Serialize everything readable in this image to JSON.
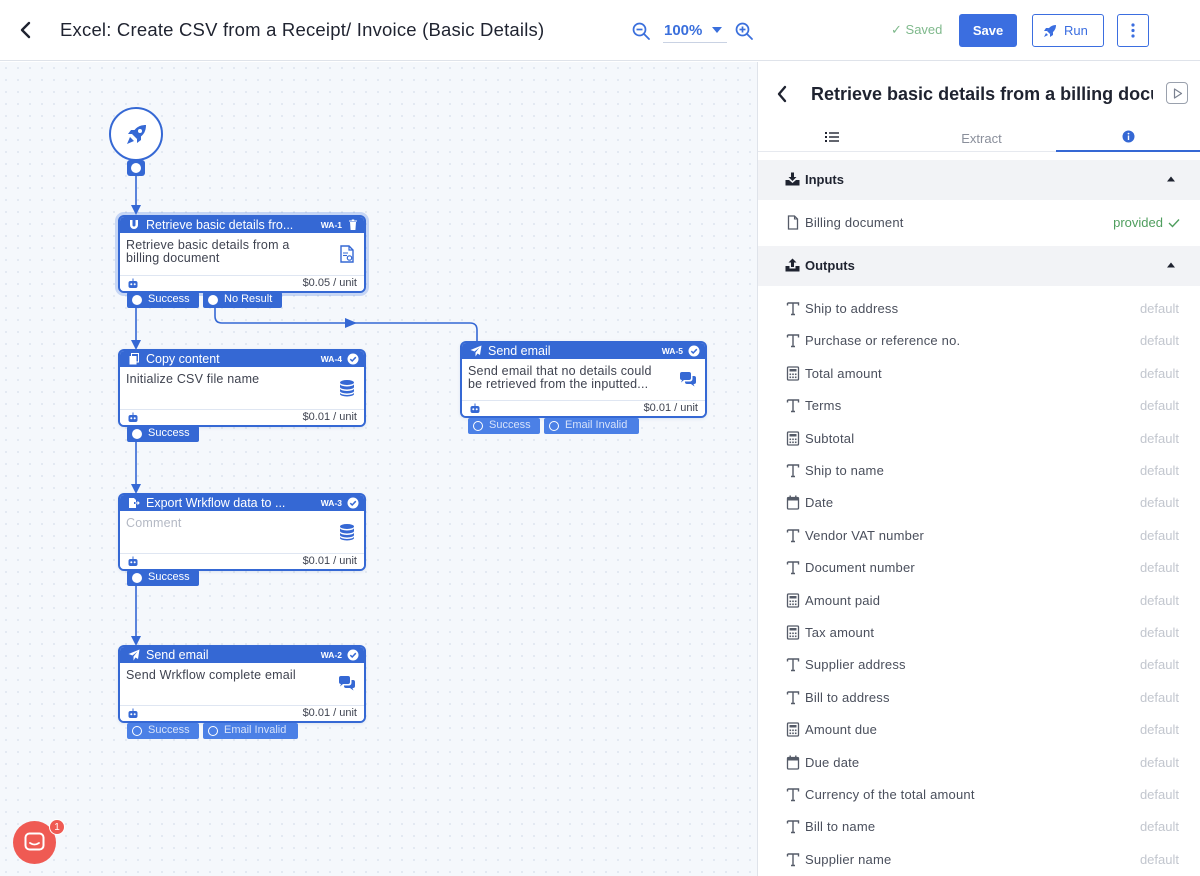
{
  "header": {
    "title": "Excel: Create CSV from a Receipt/ Invoice (Basic Details)",
    "zoom": "100%",
    "saved_label": "Saved",
    "save_label": "Save",
    "run_label": "Run"
  },
  "canvas": {
    "nodes": [
      {
        "title": "Retrieve basic details fro...",
        "id": "WA-1",
        "body": "Retrieve basic details from a billing document",
        "price": "$0.05 / unit",
        "ports": [
          "Success",
          "No Result"
        ]
      },
      {
        "title": "Copy content",
        "id": "WA-4",
        "body": "Initialize CSV file name",
        "price": "$0.01 / unit",
        "ports": [
          "Success"
        ]
      },
      {
        "title": "Export Wrkflow data to ...",
        "id": "WA-3",
        "body": "Comment",
        "price": "$0.01 / unit",
        "ports": [
          "Success"
        ]
      },
      {
        "title": "Send email",
        "id": "WA-2",
        "body": "Send Wrkflow complete email",
        "price": "$0.01 / unit",
        "ports": [
          "Success",
          "Email Invalid"
        ]
      },
      {
        "title": "Send email",
        "id": "WA-5",
        "body": "Send email that no details could be retrieved from the inputted...",
        "price": "$0.01 / unit",
        "ports": [
          "Success",
          "Email Invalid"
        ]
      }
    ],
    "chat_badge": "1"
  },
  "panel": {
    "title": "Retrieve basic details from a billing document",
    "tab_extract": "Extract",
    "inputs": {
      "title": "Inputs",
      "items": [
        {
          "label": "Billing document",
          "status": "provided"
        }
      ]
    },
    "outputs": {
      "title": "Outputs",
      "items": [
        {
          "label": "Ship to address",
          "status": "default",
          "type": "text-icon"
        },
        {
          "label": "Purchase or reference no.",
          "status": "default",
          "type": "text-icon"
        },
        {
          "label": "Total amount",
          "status": "default",
          "type": "calculator-icon"
        },
        {
          "label": "Terms",
          "status": "default",
          "type": "text-icon"
        },
        {
          "label": "Subtotal",
          "status": "default",
          "type": "calculator-icon"
        },
        {
          "label": "Ship to name",
          "status": "default",
          "type": "text-icon"
        },
        {
          "label": "Date",
          "status": "default",
          "type": "calendar-icon"
        },
        {
          "label": "Vendor VAT number",
          "status": "default",
          "type": "text-icon"
        },
        {
          "label": "Document number",
          "status": "default",
          "type": "text-icon"
        },
        {
          "label": "Amount paid",
          "status": "default",
          "type": "calculator-icon"
        },
        {
          "label": "Tax amount",
          "status": "default",
          "type": "calculator-icon"
        },
        {
          "label": "Supplier address",
          "status": "default",
          "type": "text-icon"
        },
        {
          "label": "Bill to address",
          "status": "default",
          "type": "text-icon"
        },
        {
          "label": "Amount due",
          "status": "default",
          "type": "calculator-icon"
        },
        {
          "label": "Due date",
          "status": "default",
          "type": "calendar-icon"
        },
        {
          "label": "Currency of the total amount",
          "status": "default",
          "type": "text-icon"
        },
        {
          "label": "Bill to name",
          "status": "default",
          "type": "text-icon"
        },
        {
          "label": "Supplier name",
          "status": "default",
          "type": "text-icon"
        }
      ]
    }
  }
}
